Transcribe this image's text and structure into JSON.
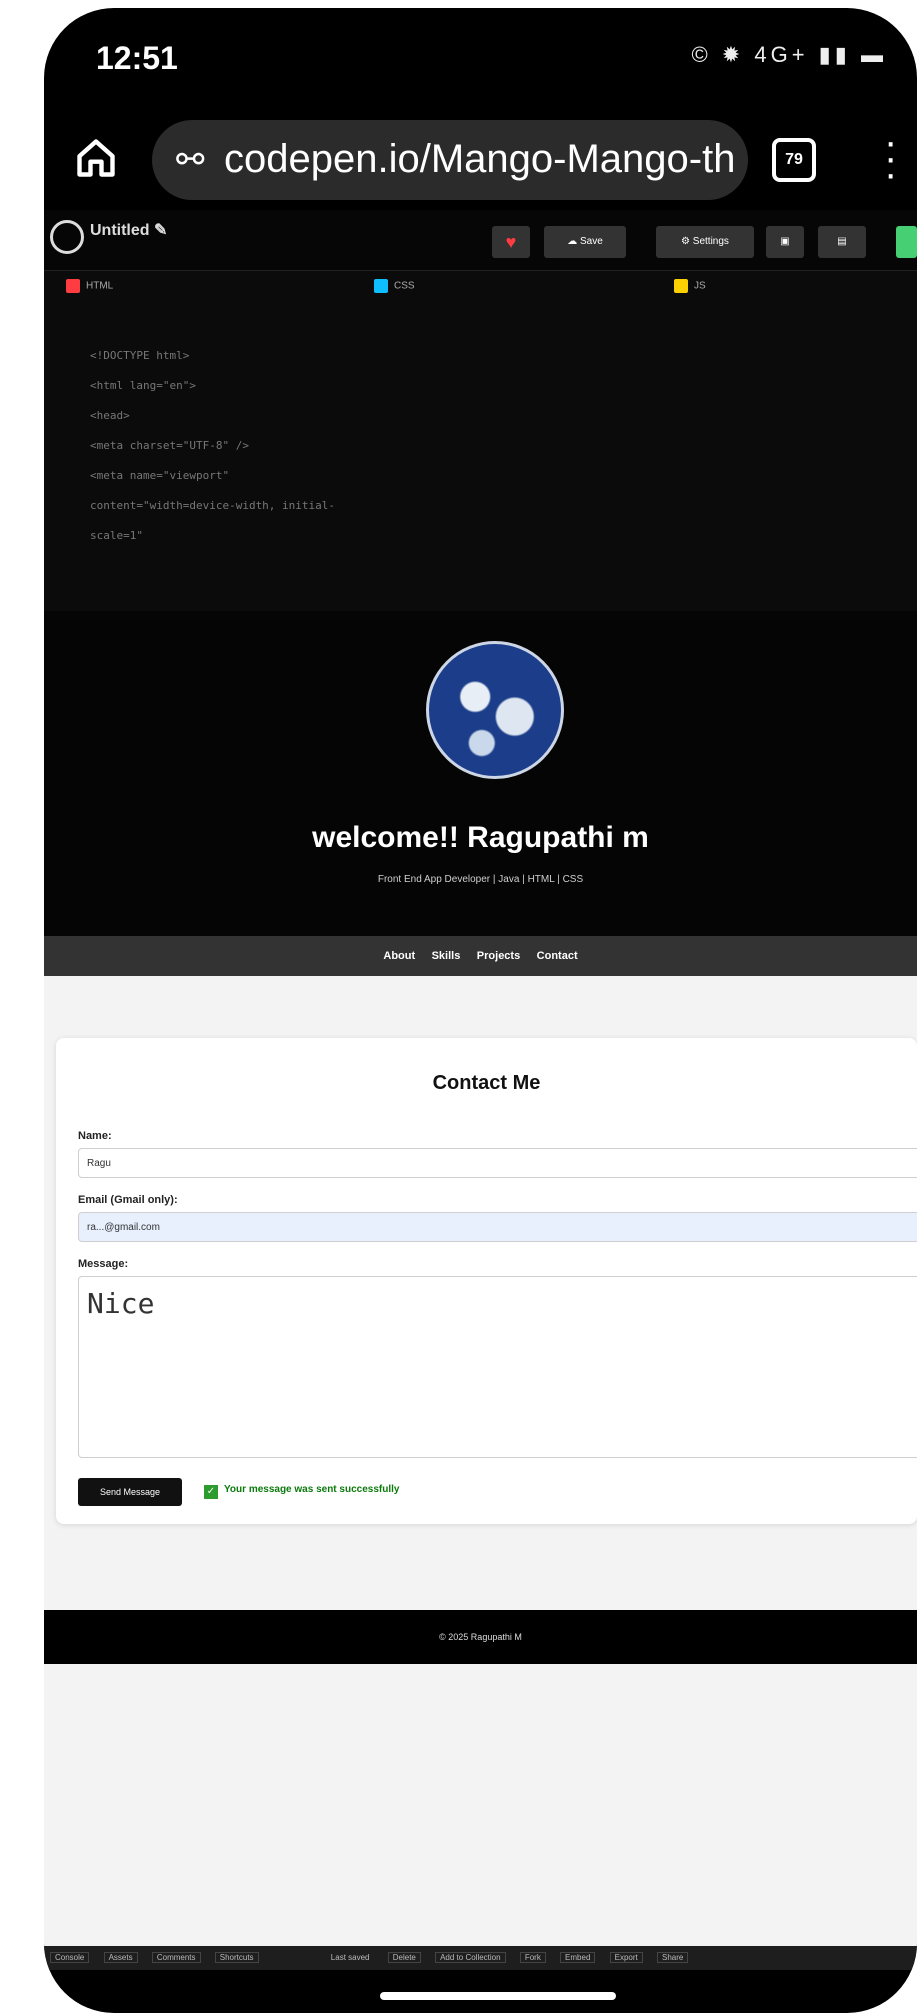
{
  "status": {
    "time": "12:51",
    "icons": "© ✹ 4G+ ▮▮ ▬"
  },
  "browser": {
    "url": "codepen.io/Mango-Mango-the-r",
    "tabs_count": "79"
  },
  "codepen": {
    "title": "Untitled ✎",
    "subtitle": "",
    "save_label": "Save",
    "settings_label": "Settings",
    "panes": [
      {
        "label": "HTML",
        "color": "#ff3c41"
      },
      {
        "label": "CSS",
        "color": "#0ebeff"
      },
      {
        "label": "JS",
        "color": "#fcd000"
      }
    ],
    "code_lines": [
      "<!DOCTYPE html>",
      "<html lang=\"en\">",
      "<head>",
      "  <meta charset=\"UTF-8\" />",
      "  <meta name=\"viewport\" content=\"width=device-width, initial-scale=1\""
    ]
  },
  "preview": {
    "heading": "welcome!! Ragupathi m",
    "tagline": "Front End App Developer | Java | HTML | CSS",
    "nav": [
      "About",
      "Skills",
      "Projects",
      "Contact"
    ],
    "contact": {
      "title": "Contact Me",
      "name_label": "Name:",
      "name_value": "Ragu",
      "email_label": "Email (Gmail only):",
      "email_value": "ra...@gmail.com",
      "message_label": "Message:",
      "message_value": "Nice",
      "send_label": "Send Message",
      "success": "Your message was sent successfully"
    },
    "footer": "© 2025 Ragupathi M"
  },
  "bottom_bar": [
    "Console",
    "Assets",
    "Comments",
    "Shortcuts",
    "Last saved",
    "Delete",
    "Add to Collection",
    "Fork",
    "Embed",
    "Export",
    "Share"
  ]
}
